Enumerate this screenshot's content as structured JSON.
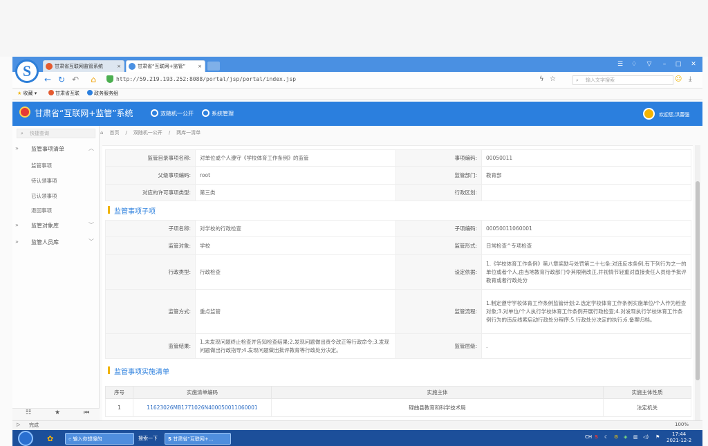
{
  "browser": {
    "tabs": [
      {
        "label": "甘肃省互联网监管系统",
        "close": "×"
      },
      {
        "label": "甘肃省“互联网+监管”",
        "close": "×"
      }
    ],
    "url": "http://59.219.193.252:8088/portal/jsp/portal/index.jsp",
    "search_placeholder": "输入文字搜索",
    "bookmarks": [
      "收藏",
      "甘肃省互联",
      "政务服务组"
    ],
    "status_left": "完成",
    "zoom": "100%"
  },
  "app": {
    "title": "甘肃省“互联网+监管”系统",
    "nav": [
      "双随机一公开",
      "系统管理"
    ],
    "welcome": "欢迎您,洪蕾强"
  },
  "sidebar": {
    "search_placeholder": "快捷查询",
    "groups": [
      {
        "label": "监管事项清单",
        "items": [
          "监管事项",
          "待认领事项",
          "已认领事项",
          "退回事项"
        ]
      },
      {
        "label": "监管对象库"
      },
      {
        "label": "监管人员库"
      }
    ]
  },
  "breadcrumb": [
    "首页",
    "双随机一公开",
    "两库一清单"
  ],
  "basic": {
    "rows": [
      {
        "label1": "监管目录事项名称:",
        "value1": "对单位或个人遵守《学校体育工作条例》的监管",
        "label2": "事项编码:",
        "value2": "00050011"
      },
      {
        "label1": "父级事项编码:",
        "value1": "root",
        "label2": "监管部门:",
        "value2": "教育部"
      },
      {
        "label1": "对应的许可事项类型:",
        "value1": "第三类",
        "label2": "行政区划:",
        "value2": ""
      }
    ]
  },
  "sub_section": {
    "title": "监管事项子项",
    "rows": [
      {
        "label1": "子项名称:",
        "value1": "对学校的行政检查",
        "label2": "子项编码:",
        "value2": "00050011060001"
      },
      {
        "label1": "监管对象:",
        "value1": "学校",
        "label2": "监管形式:",
        "value2": "日常检查^专项检查"
      },
      {
        "label1": "行政类型:",
        "value1": "行政检查",
        "label2": "设定依据:",
        "value2": "1.《学校体育工作条例》第八章奖励与处罚第二十七条:对违反本条例,有下列行为之一的单位或者个人,由当地教育行政部门令其限期改正,并视情节轻重对直接责任人员给予批评教育或者行政处分"
      },
      {
        "label1": "监管方式:",
        "value1": "重点监管",
        "label2": "监管流程:",
        "value2": "1.制定遵守学校体育工作条例监管计划;2.选定学校体育工作条例实施单位/个人作为检查对象;3.对单位/个人执行学校体育工作条例开展行政检查;4.对发现执行学校体育工作条例行为的违反线索启动行政处分程序;5.行政处分决定的执行;6.备案归档。"
      },
      {
        "label1": "监管结果:",
        "value1": "1.未发现问题终止检查并告知检查结果;2.发现问题做出责令改正等行政命令;3.发现问题做出行政指导;4.发现问题做出批评教育等行政处分决定。",
        "label2": "监管层级:",
        "value2": "."
      }
    ]
  },
  "impl_section": {
    "title": "监管事项实施清单",
    "headers": [
      "序号",
      "实施清单编码",
      "实施主体",
      "实施主体性质"
    ],
    "rows": [
      {
        "no": "1",
        "code": "11623026MB1771026N400050011060001",
        "subject": "碌曲县教育和科学技术局",
        "nature": "法定机关"
      }
    ]
  },
  "taskbar": {
    "items": [
      "输入你想搜的",
      "搜索一下",
      "甘肃省“互联网+..."
    ],
    "clock_time": "17:44",
    "clock_date": "2021-12-2",
    "tray_lang": "CH"
  }
}
